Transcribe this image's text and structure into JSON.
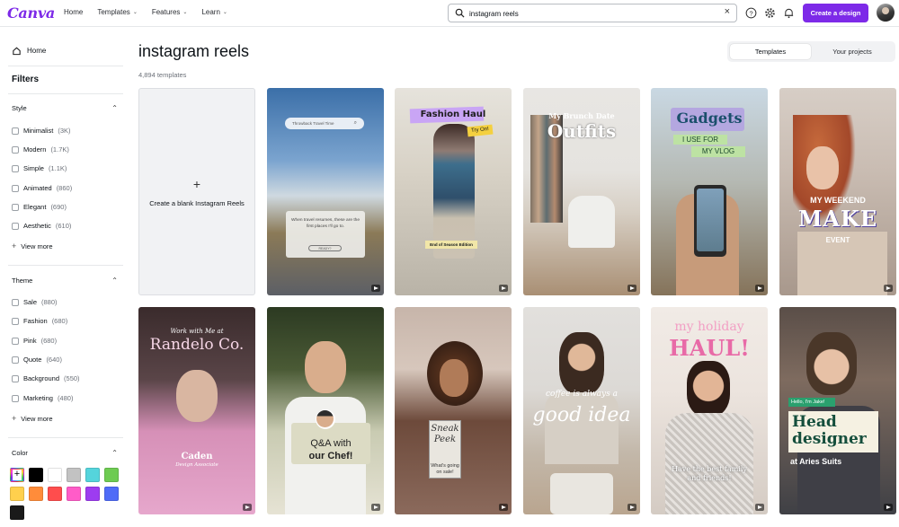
{
  "app": {
    "logo": "Canva"
  },
  "nav": [
    {
      "label": "Home"
    },
    {
      "label": "Templates"
    },
    {
      "label": "Features"
    },
    {
      "label": "Learn"
    }
  ],
  "search": {
    "value": "instagram reels"
  },
  "toolbar": {
    "create_label": "Create a design"
  },
  "sidebar": {
    "home": "Home",
    "filters": "Filters",
    "style": {
      "title": "Style",
      "options": [
        {
          "label": "Minimalist",
          "count": "(3K)"
        },
        {
          "label": "Modern",
          "count": "(1.7K)"
        },
        {
          "label": "Simple",
          "count": "(1.1K)"
        },
        {
          "label": "Animated",
          "count": "(860)"
        },
        {
          "label": "Elegant",
          "count": "(690)"
        },
        {
          "label": "Aesthetic",
          "count": "(610)"
        }
      ],
      "view_more": "View more"
    },
    "theme": {
      "title": "Theme",
      "options": [
        {
          "label": "Sale",
          "count": "(880)"
        },
        {
          "label": "Fashion",
          "count": "(680)"
        },
        {
          "label": "Pink",
          "count": "(680)"
        },
        {
          "label": "Quote",
          "count": "(640)"
        },
        {
          "label": "Background",
          "count": "(550)"
        },
        {
          "label": "Marketing",
          "count": "(480)"
        }
      ],
      "view_more": "View more"
    },
    "color": {
      "title": "Color",
      "swatches": [
        "multicolor",
        "#000000",
        "#ffffff",
        "#c2c2c2",
        "#55d4dc",
        "#6ecb52",
        "#ffd04d",
        "#ff8c3a",
        "#ff4d4d",
        "#ff5cc8",
        "#9d3cf0",
        "#4f6bf7",
        "#1a1a1a"
      ]
    }
  },
  "main": {
    "title": "instagram reels",
    "count": "4,894 templates",
    "tabs": [
      {
        "label": "Templates"
      },
      {
        "label": "Your projects"
      }
    ],
    "blank_label": "Create a blank Instagram Reels"
  },
  "cards": {
    "c1": {
      "search": "Throwback Travel Time",
      "body": "When travel resumes, these are the first places I'll go to.",
      "btn": "READY?"
    },
    "c2": {
      "title": "Fashion Haul",
      "badge": "Try On!",
      "footer": "End of Season Edition"
    },
    "c3": {
      "line1": "My Brunch Date",
      "line2": "Outfits"
    },
    "c4": {
      "title": "Gadgets",
      "line1": "I USE FOR",
      "line2": "MY VLOG"
    },
    "c5": {
      "line1": "MY WEEKEND",
      "line2": "MAKE",
      "line3": "EVENT"
    },
    "c6": {
      "line1": "Work with Me at",
      "line2": "Randelo Co.",
      "name": "Caden",
      "role": "Design Associate"
    },
    "c7": {
      "line1": "Q&A with",
      "line2": "our Chef!"
    },
    "c8": {
      "line1": "Sneak",
      "line2": "Peek",
      "line3": "What's going on sale!"
    },
    "c9": {
      "line1": "coffee is always a",
      "line2": "good idea"
    },
    "c10": {
      "line1": "my holiday",
      "line2": "HAUL!",
      "line3": "Have the best family and friends!"
    },
    "c11": {
      "tag": "Hello, I'm Jake!",
      "line1": "Head",
      "line2": "designer",
      "line3": "at Aries Suits"
    }
  }
}
